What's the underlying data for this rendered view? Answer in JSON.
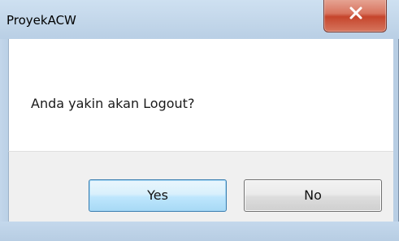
{
  "dialog": {
    "title": "ProyekACW",
    "message": "Anda yakin akan Logout?",
    "close_icon": "close-icon",
    "buttons": {
      "yes_label": "Yes",
      "no_label": "No"
    }
  },
  "colors": {
    "frame": "#c6d9ea",
    "close_button": "#c5452c",
    "default_button_border": "#3c7fb1",
    "footer": "#f0f0f0",
    "content": "#ffffff"
  }
}
